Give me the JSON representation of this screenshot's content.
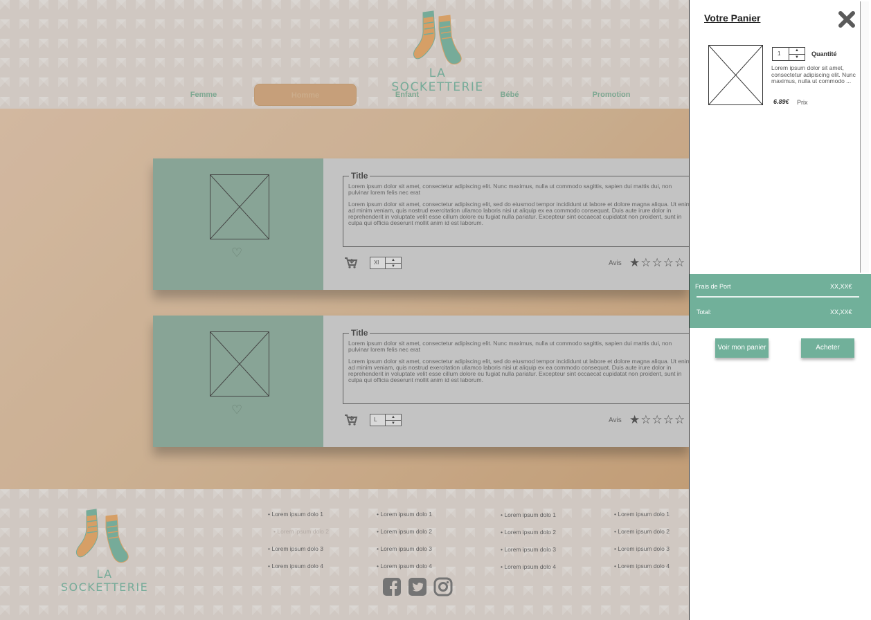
{
  "brand": {
    "name": "LA SOCKETTERIE",
    "primary_color": "#71b09a",
    "accent_color": "#d1a274"
  },
  "nav": {
    "items": [
      "Femme",
      "Homme",
      "Enfant",
      "Bébé",
      "Promotion"
    ],
    "active": "Homme"
  },
  "products": [
    {
      "title": "Title",
      "desc1": "Lorem ipsum dolor sit amet, consectetur adipiscing elit. Nunc maximus, nulla ut commodo sagittis, sapien dui mattis dui, non pulvinar lorem felis nec erat",
      "desc2": "Lorem ipsum dolor sit amet, consectetur adipiscing elit, sed do eiusmod tempor incididunt ut labore et dolore magna aliqua. Ut enim ad minim veniam, quis nostrud exercitation ullamco laboris nisi ut aliquip ex ea commodo consequat. Duis aute irure dolor in reprehenderit in voluptate velit esse cillum dolore eu fugiat nulla pariatur. Excepteur sint occaecat cupidatat non proident, sunt in culpa qui officia deserunt mollit anim id est laborum.",
      "size": "Xl",
      "avis_label": "Avis",
      "rating": 1,
      "rating_max": 5
    },
    {
      "title": "Title",
      "desc1": "Lorem ipsum dolor sit amet, consectetur adipiscing elit. Nunc maximus, nulla ut commodo sagittis, sapien dui mattis dui, non pulvinar lorem felis nec erat",
      "desc2": "Lorem ipsum dolor sit amet, consectetur adipiscing elit, sed do eiusmod tempor incididunt ut labore et dolore magna aliqua. Ut enim ad minim veniam, quis nostrud exercitation ullamco laboris nisi ut aliquip ex ea commodo consequat. Duis aute irure dolor in reprehenderit in voluptate velit esse cillum dolore eu fugiat nulla pariatur. Excepteur sint occaecat cupidatat non proident, sunt in culpa qui officia deserunt mollit anim id est laborum.",
      "size": "L",
      "avis_label": "Avis",
      "rating": 1,
      "rating_max": 5
    }
  ],
  "footer": {
    "columns": [
      [
        "Lorem ipsum dolo 1",
        "Lorem ipsum dolo 2",
        "Lorem ipsum dolo 3",
        "Lorem ipsum dolo 4"
      ],
      [
        "Lorem ipsum dolo 1",
        "Lorem ipsum dolo 2",
        "Lorem ipsum dolo 3",
        "Lorem ipsum dolo 4"
      ],
      [
        "Lorem ipsum dolo 1",
        "Lorem ipsum dolo 2",
        "Lorem ipsum dolo 3",
        "Lorem ipsum dolo 4"
      ],
      [
        "Lorem ipsum dolo 1",
        "Lorem ipsum dolo 2",
        "Lorem ipsum dolo 3",
        "Lorem ipsum dolo 4"
      ]
    ],
    "social_icons": [
      "facebook-icon",
      "twitter-icon",
      "instagram-icon"
    ]
  },
  "cart": {
    "title": "Votre Panier",
    "item": {
      "quantity": "1",
      "quantity_label": "Quantité",
      "desc": "Lorem ipsum dolor sit amet, consectetur adipiscing elit. Nunc maximus, nulla ut commodo  ...",
      "price": "6.89€",
      "price_label": "Prix"
    },
    "shipping_label": "Frais de Port",
    "shipping_value": "XX,XX€",
    "total_label": "Total:",
    "total_value": "XX,XX€",
    "view_cart_label": "Voir mon panier",
    "buy_label": "Acheter"
  }
}
